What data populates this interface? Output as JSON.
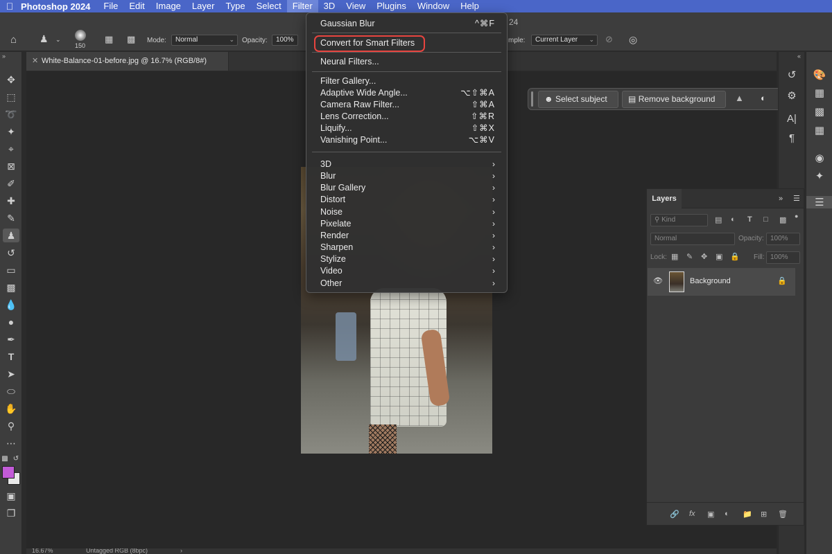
{
  "menubar": {
    "apple": "",
    "app_name": "Photoshop 2024",
    "items": [
      "File",
      "Edit",
      "Image",
      "Layer",
      "Type",
      "Select",
      "Filter",
      "3D",
      "View",
      "Plugins",
      "Window",
      "Help"
    ],
    "active_item": "Filter",
    "color": "#4a66c8"
  },
  "optionsbar": {
    "brush_size": "150",
    "mode_label": "Mode:",
    "mode_value": "Normal",
    "opacity_label": "Opacity:",
    "opacity_value": "100%",
    "sample_label": "mple:",
    "sample_value": "Current Layer",
    "title_fragment": "24"
  },
  "document": {
    "tab_title": "White-Balance-01-before.jpg @ 16.7% (RGB/8#)"
  },
  "filter_menu": {
    "last_filter": "Gaussian Blur",
    "last_filter_shortcut": "^⌘F",
    "convert_smart": "Convert for Smart Filters",
    "neural": "Neural Filters...",
    "items": [
      {
        "label": "Filter Gallery...",
        "shortcut": ""
      },
      {
        "label": "Adaptive Wide Angle...",
        "shortcut": "⌥⇧⌘A"
      },
      {
        "label": "Camera Raw Filter...",
        "shortcut": "⇧⌘A"
      },
      {
        "label": "Lens Correction...",
        "shortcut": "⇧⌘R"
      },
      {
        "label": "Liquify...",
        "shortcut": "⇧⌘X"
      },
      {
        "label": "Vanishing Point...",
        "shortcut": "⌥⌘V"
      }
    ],
    "submenus": [
      "3D",
      "Blur",
      "Blur Gallery",
      "Distort",
      "Noise",
      "Pixelate",
      "Render",
      "Sharpen",
      "Stylize",
      "Video",
      "Other"
    ],
    "highlight_color": "#e8443f"
  },
  "taskbar": {
    "select_subject": "Select subject",
    "remove_background": "Remove background",
    "more": "•••"
  },
  "layers_panel": {
    "tab": "Layers",
    "kind_placeholder": "Kind",
    "blend_mode": "Normal",
    "opacity_label": "Opacity:",
    "opacity_value": "100%",
    "lock_label": "Lock:",
    "fill_label": "Fill:",
    "fill_value": "100%",
    "layer_name": "Background"
  },
  "statusbar": {
    "zoom": "16.67%",
    "profile": "Untagged RGB (8bpc)"
  },
  "colors": {
    "foreground": "#c35bd8",
    "background": "#e8e8e8"
  }
}
